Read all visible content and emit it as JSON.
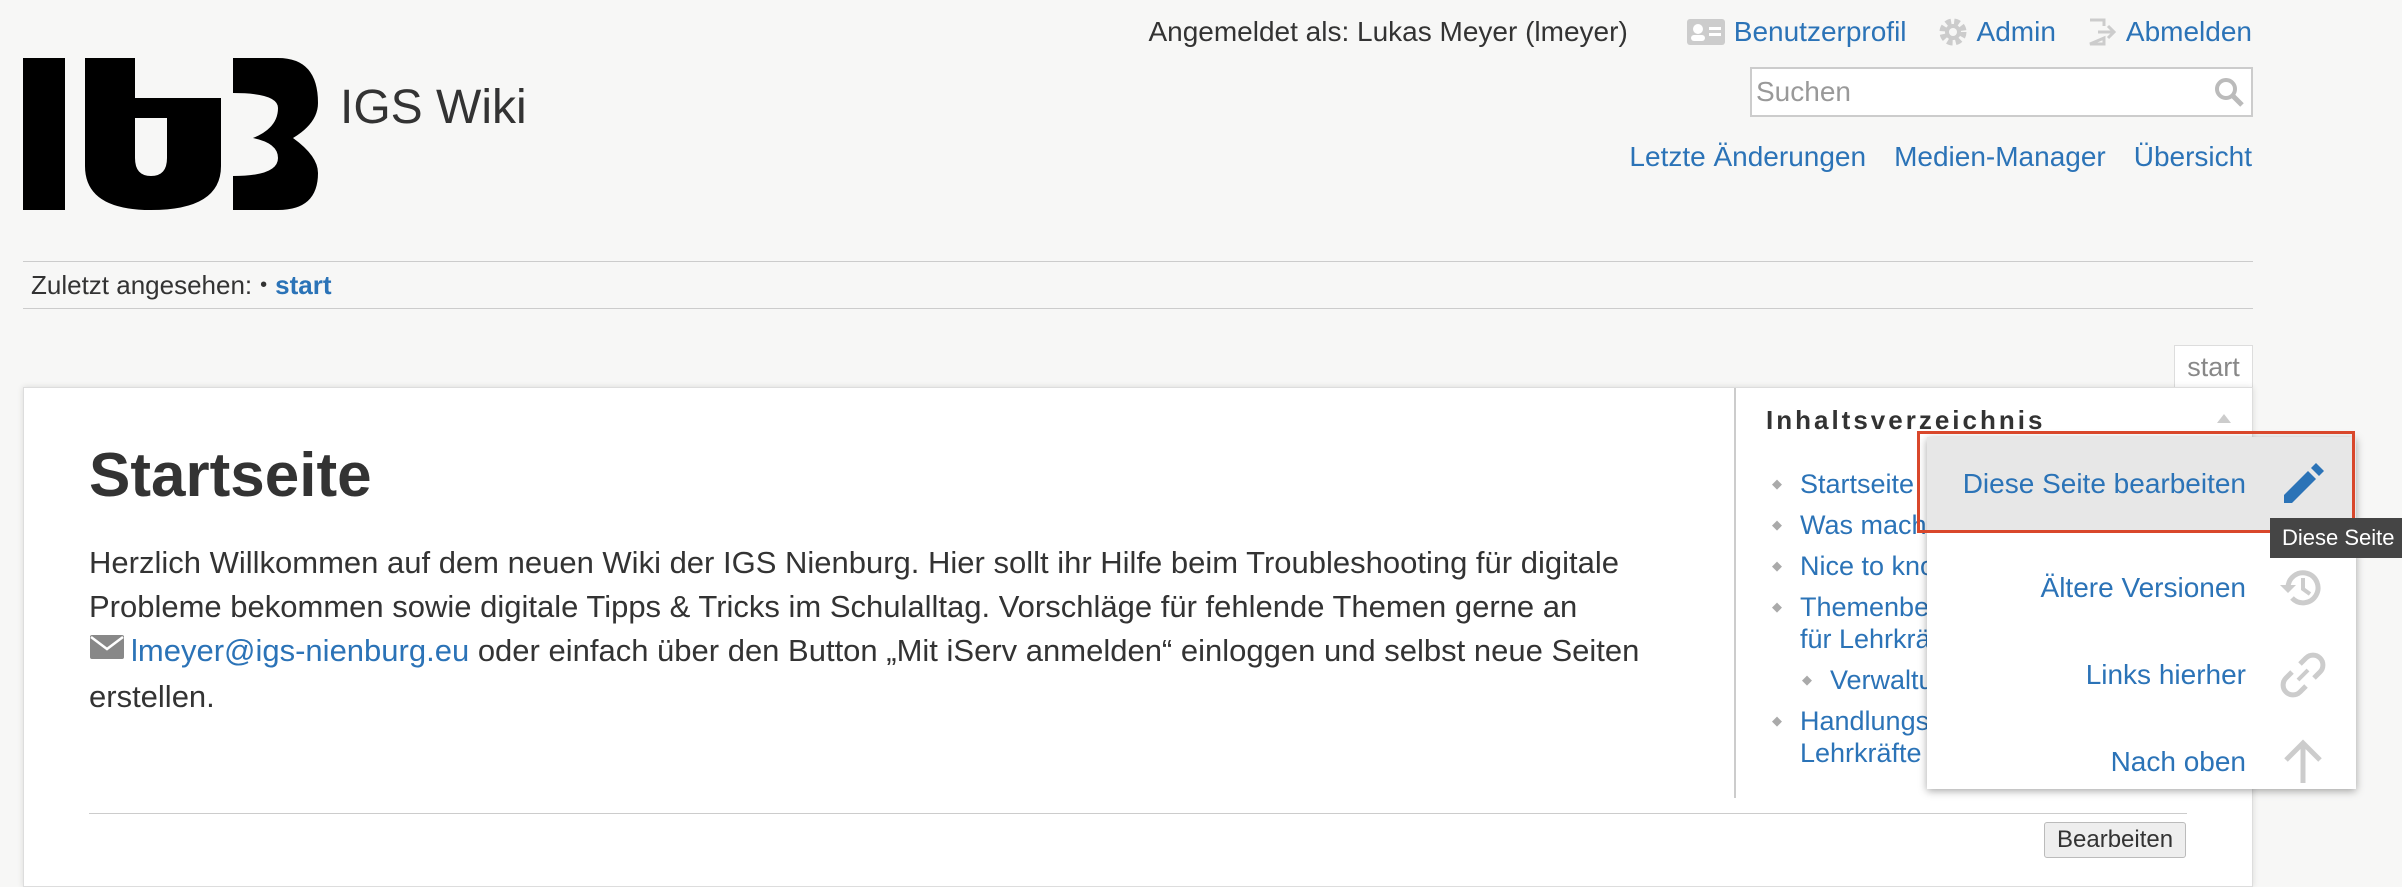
{
  "header": {
    "site_title": "IGS Wiki",
    "user_info": "Angemeldet als: Lukas Meyer (lmeyer)",
    "user_links": [
      {
        "label": "Benutzerprofil",
        "icon": "profile-card-icon"
      },
      {
        "label": "Admin",
        "icon": "gear-icon"
      },
      {
        "label": "Abmelden",
        "icon": "logout-icon"
      }
    ],
    "search_placeholder": "Suchen",
    "nav_links": [
      "Letzte Änderungen",
      "Medien-Manager",
      "Übersicht"
    ]
  },
  "breadcrumbs": {
    "label": "Zuletzt angesehen:",
    "separator": "•",
    "items": [
      "start"
    ]
  },
  "page_id": "start",
  "content": {
    "title": "Startseite",
    "intro_before": "Herzlich Willkommen auf dem neuen Wiki der IGS Nienburg. Hier sollt ihr Hilfe beim Troubleshooting für digitale Probleme bekommen sowie digitale Tipps & Tricks im Schulalltag. Vorschläge für fehlende Themen gerne an",
    "email": "lmeyer@igs-nienburg.eu",
    "intro_after": "oder einfach über den Button „Mit iServ anmelden“ einloggen und selbst neue Seiten erstellen.",
    "edit_button": "Bearbeiten"
  },
  "toc": {
    "title": "Inhaltsverzeichnis",
    "items": [
      "Startseite",
      "Was mach",
      "Nice to kno",
      "Themenbe",
      "für Lehrkrä",
      "Verwaltu",
      "Handlungs",
      "Lehrkräfte"
    ]
  },
  "page_tools": {
    "items": [
      {
        "label": "Diese Seite bearbeiten",
        "icon": "pencil-icon"
      },
      {
        "label": "Ältere Versionen",
        "icon": "history-icon"
      },
      {
        "label": "Links hierher",
        "icon": "link-icon"
      },
      {
        "label": "Nach oben",
        "icon": "arrow-up-icon"
      }
    ],
    "tooltip": "Diese Seite bearbeiten"
  },
  "colors": {
    "link": "#2b73b7",
    "highlight_border": "#d9472b",
    "background": "#f7f7f6"
  }
}
